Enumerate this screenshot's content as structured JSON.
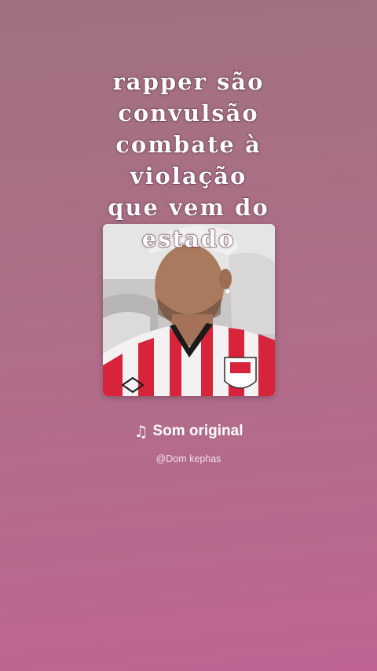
{
  "caption": {
    "text": "rapper são\nconvulsão\ncombate à\nviolação\nque vem do\nestado"
  },
  "audio": {
    "icon": "music-note-icon",
    "label": "Som original",
    "author": "@Dom kephas"
  },
  "colors": {
    "background_top": "#a0707e",
    "background_bottom": "#bf6492",
    "text": "#ffffff"
  }
}
